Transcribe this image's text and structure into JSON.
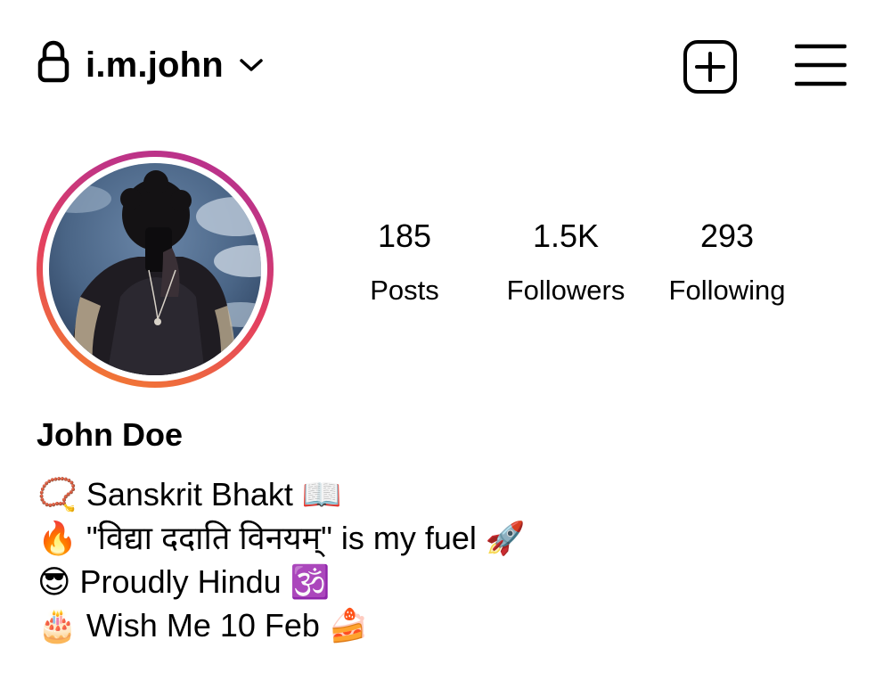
{
  "header": {
    "username": "i.m.john",
    "icons": [
      "lock-icon",
      "chevron-down-icon",
      "new-post-icon",
      "menu-icon"
    ]
  },
  "profile": {
    "avatar_icon": "profile-photo",
    "ring_colors": [
      "#f58529",
      "#e4405f",
      "#c13584"
    ],
    "display_name": "John Doe",
    "stats": [
      {
        "value": "185",
        "label": "Posts"
      },
      {
        "value": "1.5K",
        "label": "Followers"
      },
      {
        "value": "293",
        "label": "Following"
      }
    ],
    "bio": [
      "📿 Sanskrit Bhakt 📖",
      "🔥 \"विद्या ददाति विनयम्\" is my fuel 🚀",
      "😎 Proudly Hindu 🕉️",
      "🎂 Wish Me 10 Feb 🍰"
    ]
  }
}
